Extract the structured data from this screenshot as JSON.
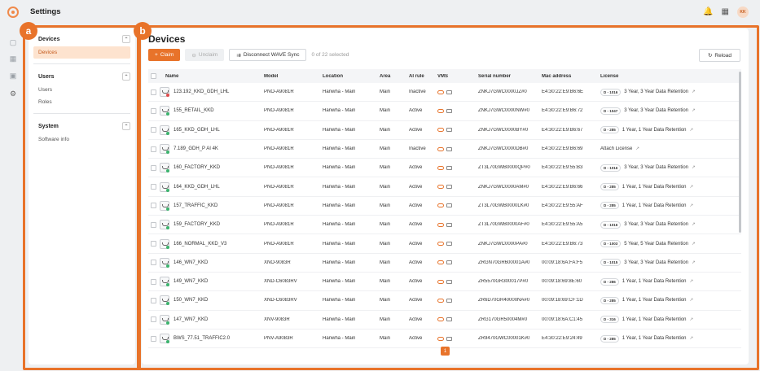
{
  "app": {
    "title": "Settings",
    "avatar_initials": "KK"
  },
  "annotations": {
    "a": "a",
    "b": "b"
  },
  "sidebar": {
    "sections": [
      {
        "title": "Devices",
        "items": [
          "Devices"
        ]
      },
      {
        "title": "Users",
        "items": [
          "Users",
          "Roles"
        ]
      },
      {
        "title": "System",
        "items": [
          "Software info"
        ]
      }
    ]
  },
  "main": {
    "title": "Devices",
    "toolbar": {
      "claim_label": "Claim",
      "unclaim_label": "Unclaim",
      "disconnect_label": "Disconnect WAVE Sync",
      "selected_text": "0 of 22 selected",
      "reload_label": "Reload"
    },
    "columns": [
      "Name",
      "Model",
      "Location",
      "Area",
      "AI rule",
      "VMS",
      "Serial number",
      "Mac address",
      "License"
    ],
    "rows": [
      {
        "name": "123.192_KKD_GDH_LHL",
        "model": "PNO-A9081R",
        "location": "Hanwha - Main",
        "area": "Main",
        "ai_rule": "Inactive",
        "serial": "ZNKJ7GWC0000JZ#0",
        "mac": "E4:30:22:E9:B6:6E",
        "license_tag": "D - 1016",
        "license": "3 Year, 3 Year Data Retention",
        "status": "red"
      },
      {
        "name": "155_RETAIL_KKD",
        "model": "PNO-A9081R",
        "location": "Hanwha - Main",
        "area": "Main",
        "ai_rule": "Active",
        "serial": "ZNKJ7GWC0000NW#0",
        "mac": "E4:30:22:E9:B6:72",
        "license_tag": "D - 1047",
        "license": "3 Year, 3 Year Data Retention",
        "status": "green"
      },
      {
        "name": "165_KKD_GDH_LHL",
        "model": "PNO-A9081R",
        "location": "Hanwha - Main",
        "area": "Main",
        "ai_rule": "Active",
        "serial": "ZNKJ7GWC0000BY#0",
        "mac": "E4:30:22:E9:B6:67",
        "license_tag": "D - 285",
        "license": "1 Year, 1 Year Data Retention",
        "status": "green"
      },
      {
        "name": "7.189_GDH_P AI 4K",
        "model": "PNO-A9081R",
        "location": "Hanwha - Main",
        "area": "Main",
        "ai_rule": "Inactive",
        "serial": "ZNKJ7GWC0000DB#0",
        "mac": "E4:30:22:E9:B6:69",
        "license_tag": "",
        "license": "Attach License",
        "status": "green"
      },
      {
        "name": "160_FACTORY_KKD",
        "model": "PNO-A9081R",
        "location": "Hanwha - Main",
        "area": "Main",
        "ai_rule": "Active",
        "serial": "ZT3L70GWB0000QP#0",
        "mac": "E4:30:22:E9:55:B3",
        "license_tag": "D - 1016",
        "license": "3 Year, 3 Year Data Retention",
        "status": "green"
      },
      {
        "name": "164_KKD_GDH_LHL",
        "model": "PNO-A9081R",
        "location": "Hanwha - Main",
        "area": "Main",
        "ai_rule": "Active",
        "serial": "ZNKJ7GWC0000AM#0",
        "mac": "E4:30:22:E9:B6:66",
        "license_tag": "D - 285",
        "license": "1 Year, 1 Year Data Retention",
        "status": "green"
      },
      {
        "name": "157_TRAFFIC_KKD",
        "model": "PNO-A9081R",
        "location": "Hanwha - Main",
        "area": "Main",
        "ai_rule": "Active",
        "serial": "ZT3L70GWB0000LK#0",
        "mac": "E4:30:22:E9:55:AF",
        "license_tag": "D - 285",
        "license": "1 Year, 1 Year Data Retention",
        "status": "green"
      },
      {
        "name": "159_FACTORY_KKD",
        "model": "PNO-A9081R",
        "location": "Hanwha - Main",
        "area": "Main",
        "ai_rule": "Active",
        "serial": "ZT3L70GWB0000AF#0",
        "mac": "E4:30:22:E9:55:A5",
        "license_tag": "D - 1016",
        "license": "3 Year, 3 Year Data Retention",
        "status": "green"
      },
      {
        "name": "166_NORMAL_KKD_V3",
        "model": "PNO-A9081R",
        "location": "Hanwha - Main",
        "area": "Main",
        "ai_rule": "Active",
        "serial": "ZNKJ7GWC0000PA#0",
        "mac": "E4:30:22:E9:B6:73",
        "license_tag": "D - 1003",
        "license": "5 Year, 5 Year Data Retention",
        "status": "green"
      },
      {
        "name": "146_WN7_KKD",
        "model": "XNO-9083R",
        "location": "Hanwha - Main",
        "area": "Main",
        "ai_rule": "Active",
        "serial": "ZRGN70GR600001A#0",
        "mac": "00:09:18:6A:FA:F5",
        "license_tag": "D - 1015",
        "license": "3 Year, 3 Year Data Retention",
        "status": "green"
      },
      {
        "name": "149_WN7_KKD",
        "model": "XND-C6083RV",
        "location": "Hanwha - Main",
        "area": "Main",
        "ai_rule": "Active",
        "serial": "ZR5570GR300017P#0",
        "mac": "00:09:18:69:8E:60",
        "license_tag": "D - 286",
        "license": "1 Year, 1 Year Data Retention",
        "status": "green"
      },
      {
        "name": "150_WN7_KKD",
        "model": "XND-C6083RV",
        "location": "Hanwha - Main",
        "area": "Main",
        "ai_rule": "Active",
        "serial": "ZR6D70GR40000NA#0",
        "mac": "00:09:18:69:CF:1D",
        "license_tag": "D - 285",
        "license": "1 Year, 1 Year Data Retention",
        "status": "green"
      },
      {
        "name": "147_WN7_KKD",
        "model": "XNV-9083R",
        "location": "Hanwha - Main",
        "area": "Main",
        "ai_rule": "Active",
        "serial": "ZRG170GR50004M#0",
        "mac": "00:09:18:6A:C1:45",
        "license_tag": "D - 316",
        "license": "1 Year, 1 Year Data Retention",
        "status": "green"
      },
      {
        "name": "BWS_77.51_TRAFFIC2.0",
        "model": "PNV-A9083R",
        "location": "Hanwha - Main",
        "area": "Main",
        "ai_rule": "Active",
        "serial": "ZR9470GWC00001K#0",
        "mac": "E4:30:22:E9:24:49",
        "license_tag": "D - 285",
        "license": "1 Year, 1 Year Data Retention",
        "status": "green"
      }
    ],
    "page": "1"
  },
  "colors": {
    "accent": "#e8732a",
    "status_green": "#3cb46e",
    "status_red": "#e14b4b"
  }
}
